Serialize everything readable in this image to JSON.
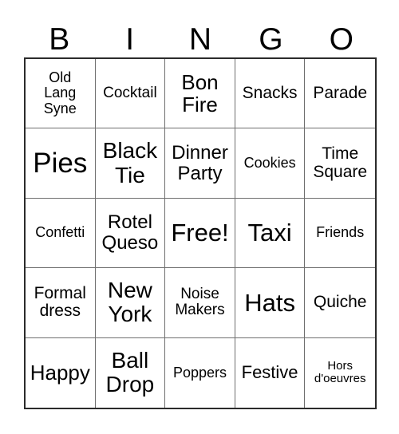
{
  "card": {
    "title": "BINGO",
    "headers": [
      "B",
      "I",
      "N",
      "G",
      "O"
    ],
    "free_space_label": "Free!",
    "colors": {
      "background": "#ffffff",
      "text": "#000000",
      "outer_border": "#2b2b2b",
      "inner_border": "#6f6f6f"
    },
    "grid_size": "5x5",
    "rows": [
      [
        {
          "text": "Old\nLang\nSyne",
          "size": "s-sm"
        },
        {
          "text": "Cocktail",
          "size": "s-smp"
        },
        {
          "text": "Bon\nFire",
          "size": "s-lgp"
        },
        {
          "text": "Snacks",
          "size": "s-md"
        },
        {
          "text": "Parade",
          "size": "s-md"
        }
      ],
      [
        {
          "text": "Pies",
          "size": "s-huge"
        },
        {
          "text": "Black\nTie",
          "size": "s-xl"
        },
        {
          "text": "Dinner\nParty",
          "size": "s-lg"
        },
        {
          "text": "Cookies",
          "size": "s-sm"
        },
        {
          "text": "Time\nSquare",
          "size": "s-md"
        }
      ],
      [
        {
          "text": "Confetti",
          "size": "s-sm"
        },
        {
          "text": "Rotel\nQueso",
          "size": "s-lg"
        },
        {
          "text": "Free!",
          "size": "s-xxl"
        },
        {
          "text": "Taxi",
          "size": "s-xxl"
        },
        {
          "text": "Friends",
          "size": "s-sm"
        }
      ],
      [
        {
          "text": "Formal\ndress",
          "size": "s-md"
        },
        {
          "text": "New\nYork",
          "size": "s-xl"
        },
        {
          "text": "Noise\nMakers",
          "size": "s-smp"
        },
        {
          "text": "Hats",
          "size": "s-xxl"
        },
        {
          "text": "Quiche",
          "size": "s-md"
        }
      ],
      [
        {
          "text": "Happy",
          "size": "s-lgp"
        },
        {
          "text": "Ball\nDrop",
          "size": "s-xl"
        },
        {
          "text": "Poppers",
          "size": "s-sm"
        },
        {
          "text": "Festive",
          "size": "s-mdp"
        },
        {
          "text": "Hors\nd'oeuvres",
          "size": "s-xxs"
        }
      ]
    ]
  }
}
